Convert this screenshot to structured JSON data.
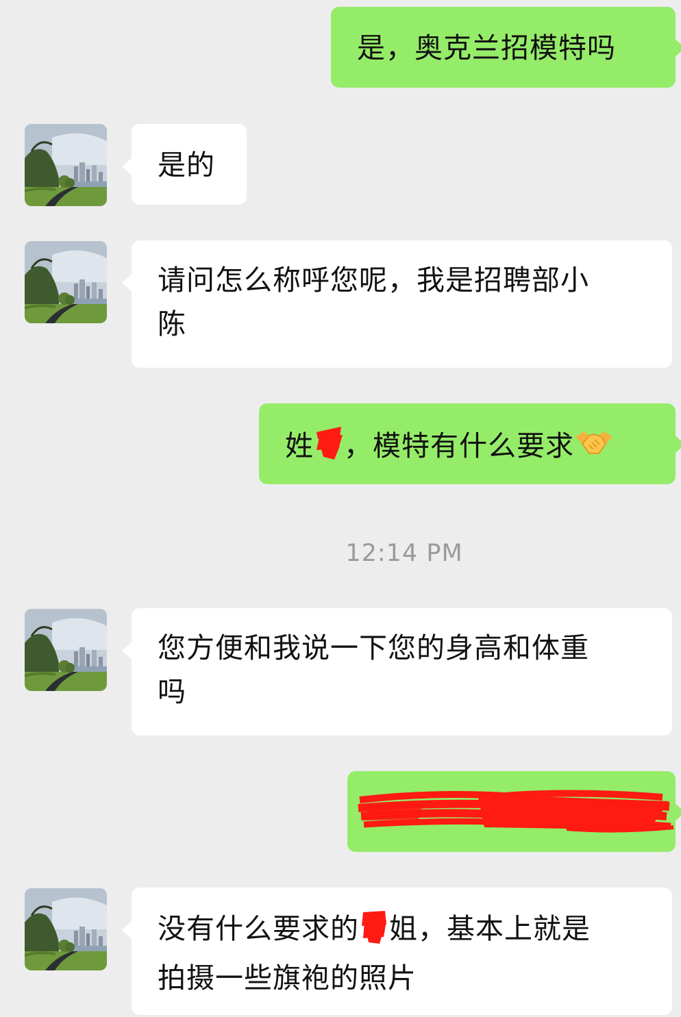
{
  "colors": {
    "background": "#ededed",
    "incoming_bubble": "#ffffff",
    "outgoing_bubble": "#95ec69",
    "redaction": "#ff1a12",
    "timestamp": "#9a9a9a"
  },
  "messages": [
    {
      "side": "out",
      "text": "是，奥克兰招模特吗"
    },
    {
      "side": "in",
      "avatar_icon": "landscape-avatar-icon",
      "text": "是的"
    },
    {
      "side": "in",
      "avatar_icon": "landscape-avatar-icon",
      "line1": "请问怎么称呼您呢，我是招聘部小",
      "line2": "陈"
    },
    {
      "side": "out",
      "text_before": "姓",
      "text_after": "，模特有什么要求",
      "redacted": true,
      "emoji": "handshake-emoji"
    },
    {
      "timestamp": "12:14 PM"
    },
    {
      "side": "in",
      "avatar_icon": "landscape-avatar-icon",
      "line1": "您方便和我说一下您的身高和体重",
      "line2": "吗"
    },
    {
      "side": "out",
      "redacted_full": true
    },
    {
      "side": "in",
      "avatar_icon": "landscape-avatar-icon",
      "line1_before": "没有什么要求的",
      "line1_after": "姐，基本上就是",
      "line2": "拍摄一些旗袍的照片",
      "redacted": true
    }
  ]
}
